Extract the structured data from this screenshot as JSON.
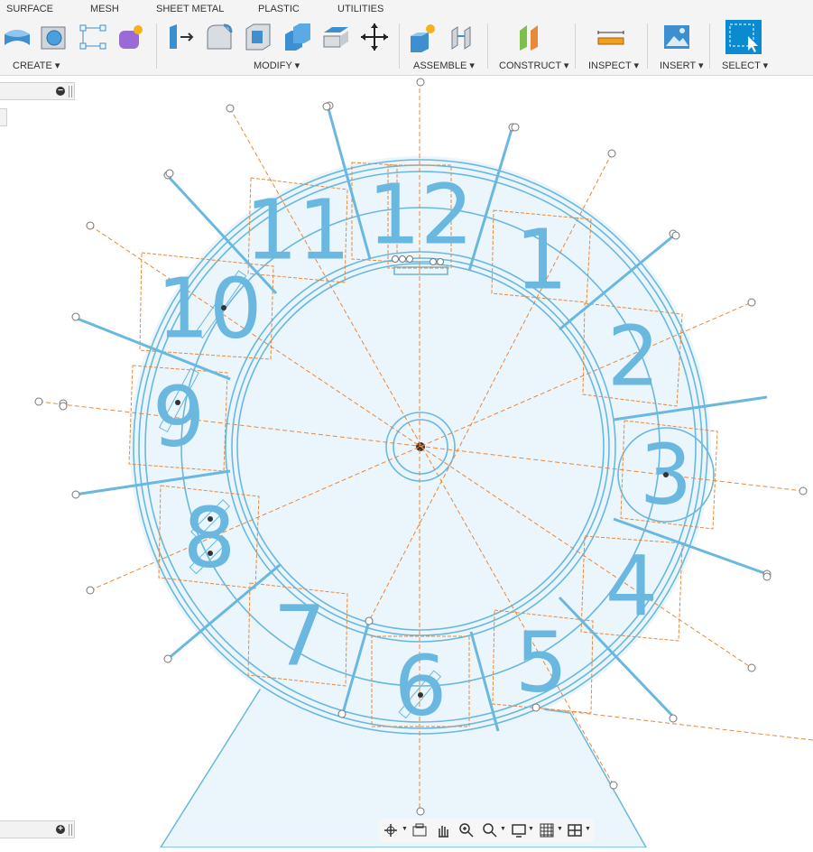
{
  "tabs": [
    "SURFACE",
    "MESH",
    "SHEET METAL",
    "PLASTIC",
    "UTILITIES"
  ],
  "toolbar": {
    "groups": [
      "CREATE ▾",
      "MODIFY ▾",
      "ASSEMBLE ▾",
      "CONSTRUCT ▾",
      "INSPECT ▾",
      "INSERT ▾",
      "SELECT ▾"
    ],
    "icons": {
      "create": [
        "extrude-icon",
        "revolve-icon",
        "sketch-icon",
        "form-icon"
      ],
      "modify": [
        "press-pull-icon",
        "fillet-icon",
        "shell-icon",
        "combine-icon",
        "offset-face-icon",
        "move-icon"
      ],
      "assemble": [
        "new-component-icon",
        "joint-icon"
      ],
      "construct": [
        "plane-icon"
      ],
      "inspect": [
        "measure-icon"
      ],
      "insert": [
        "insert-image-icon"
      ],
      "select": [
        "select-icon"
      ]
    }
  },
  "panels": {
    "top_button": "−",
    "bottom_button": "+"
  },
  "clock": {
    "numerals": [
      "12",
      "1",
      "2",
      "3",
      "4",
      "5",
      "6",
      "7",
      "8",
      "9",
      "10",
      "11"
    ]
  },
  "colors": {
    "sketch_blue": "#6ab8e0",
    "face_fill": "#eaf5fc",
    "construction": "#e8893a",
    "select_accent": "#0a8bd0"
  },
  "navbar": {
    "icons": [
      "orbit-icon",
      "look-at-icon",
      "pan-icon",
      "zoom-icon",
      "zoom-window-icon",
      "display-settings-icon",
      "grid-icon",
      "viewports-icon"
    ]
  }
}
